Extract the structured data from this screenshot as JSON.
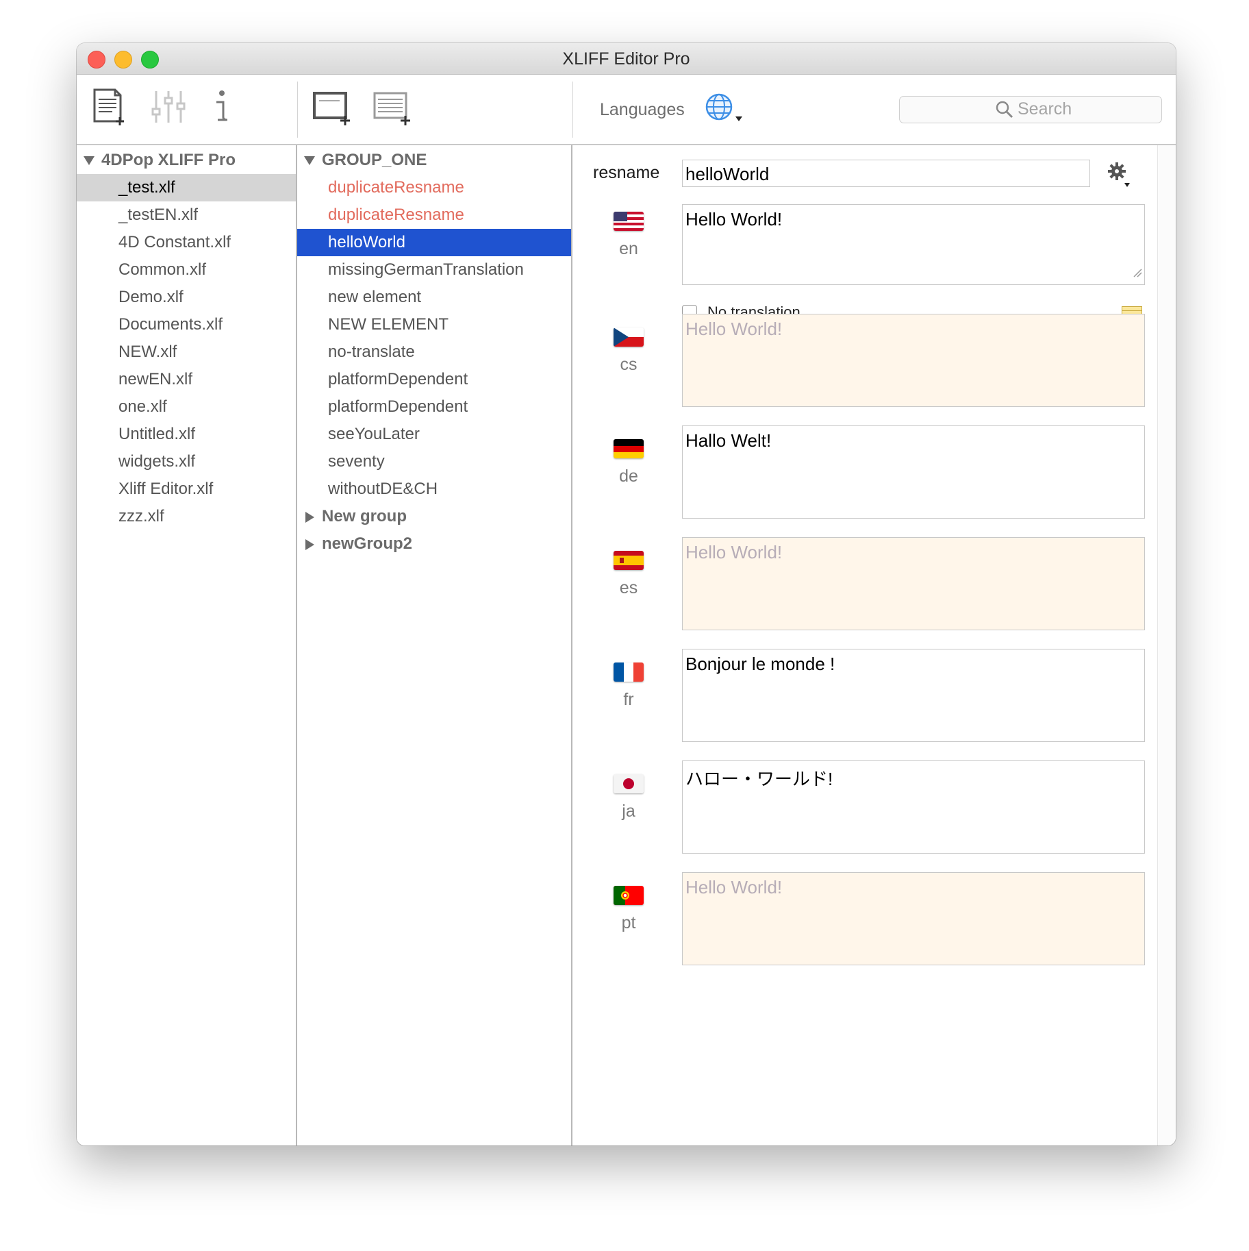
{
  "window": {
    "title": "XLIFF Editor Pro"
  },
  "toolbar": {
    "languages_label": "Languages",
    "search_placeholder": "Search"
  },
  "files": {
    "root": "4DPop XLIFF Pro",
    "items": [
      "_test.xlf",
      "_testEN.xlf",
      "4D Constant.xlf",
      "Common.xlf",
      "Demo.xlf",
      "Documents.xlf",
      "NEW.xlf",
      "newEN.xlf",
      "one.xlf",
      "Untitled.xlf",
      "widgets.xlf",
      "Xliff Editor.xlf",
      "zzz.xlf"
    ],
    "selected": "_test.xlf"
  },
  "groups": {
    "group_one": "GROUP_ONE",
    "items": [
      "duplicateResname",
      "duplicateResname",
      "helloWorld",
      "missingGermanTranslation",
      "new element",
      "NEW ELEMENT",
      "no-translate",
      "platformDependent",
      "platformDependent",
      "seeYouLater",
      "seventy",
      "withoutDE&CH"
    ],
    "collapsed": [
      "New group",
      "newGroup2"
    ],
    "selected": "helloWorld"
  },
  "editor": {
    "resname_label": "resname",
    "resname_value": "helloWorld",
    "no_translation_label": "No translation",
    "translations": [
      {
        "code": "en",
        "text": "Hello World!",
        "state": "source"
      },
      {
        "code": "cs",
        "text": "Hello World!",
        "state": "fallback"
      },
      {
        "code": "de",
        "text": "Hallo Welt!",
        "state": "translated"
      },
      {
        "code": "es",
        "text": "Hello World!",
        "state": "fallback"
      },
      {
        "code": "fr",
        "text": "Bonjour le monde !",
        "state": "translated"
      },
      {
        "code": "ja",
        "text": "ハロー・ワールド!",
        "state": "translated"
      },
      {
        "code": "pt",
        "text": "Hello World!",
        "state": "fallback"
      }
    ]
  },
  "colors": {
    "selection": "#1f53d0",
    "duplicate": "#e26b5d",
    "fallback_bg": "#fff6ea"
  }
}
